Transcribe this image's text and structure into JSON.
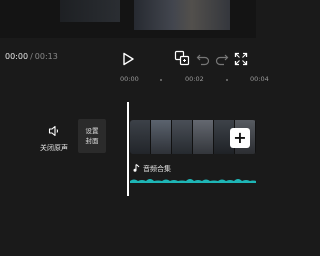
{
  "playback": {
    "current_time": "00:00",
    "separator": "/",
    "duration": "00:13"
  },
  "toolbar": {
    "play_icon": "play-icon",
    "keyframe_icon": "keyframe-icon",
    "undo_icon": "undo-icon",
    "redo_icon": "redo-icon",
    "fullscreen_icon": "fullscreen-icon"
  },
  "ruler": {
    "ticks": [
      "00:00",
      "00:02",
      "00:04"
    ]
  },
  "track_controls": {
    "mute_label": "关闭原声",
    "cover_line1": "设置",
    "cover_line2": "封面"
  },
  "video_track": {
    "add_button": "+"
  },
  "audio_track": {
    "label": "音频合集",
    "wave_color": "#1fc8c8"
  }
}
